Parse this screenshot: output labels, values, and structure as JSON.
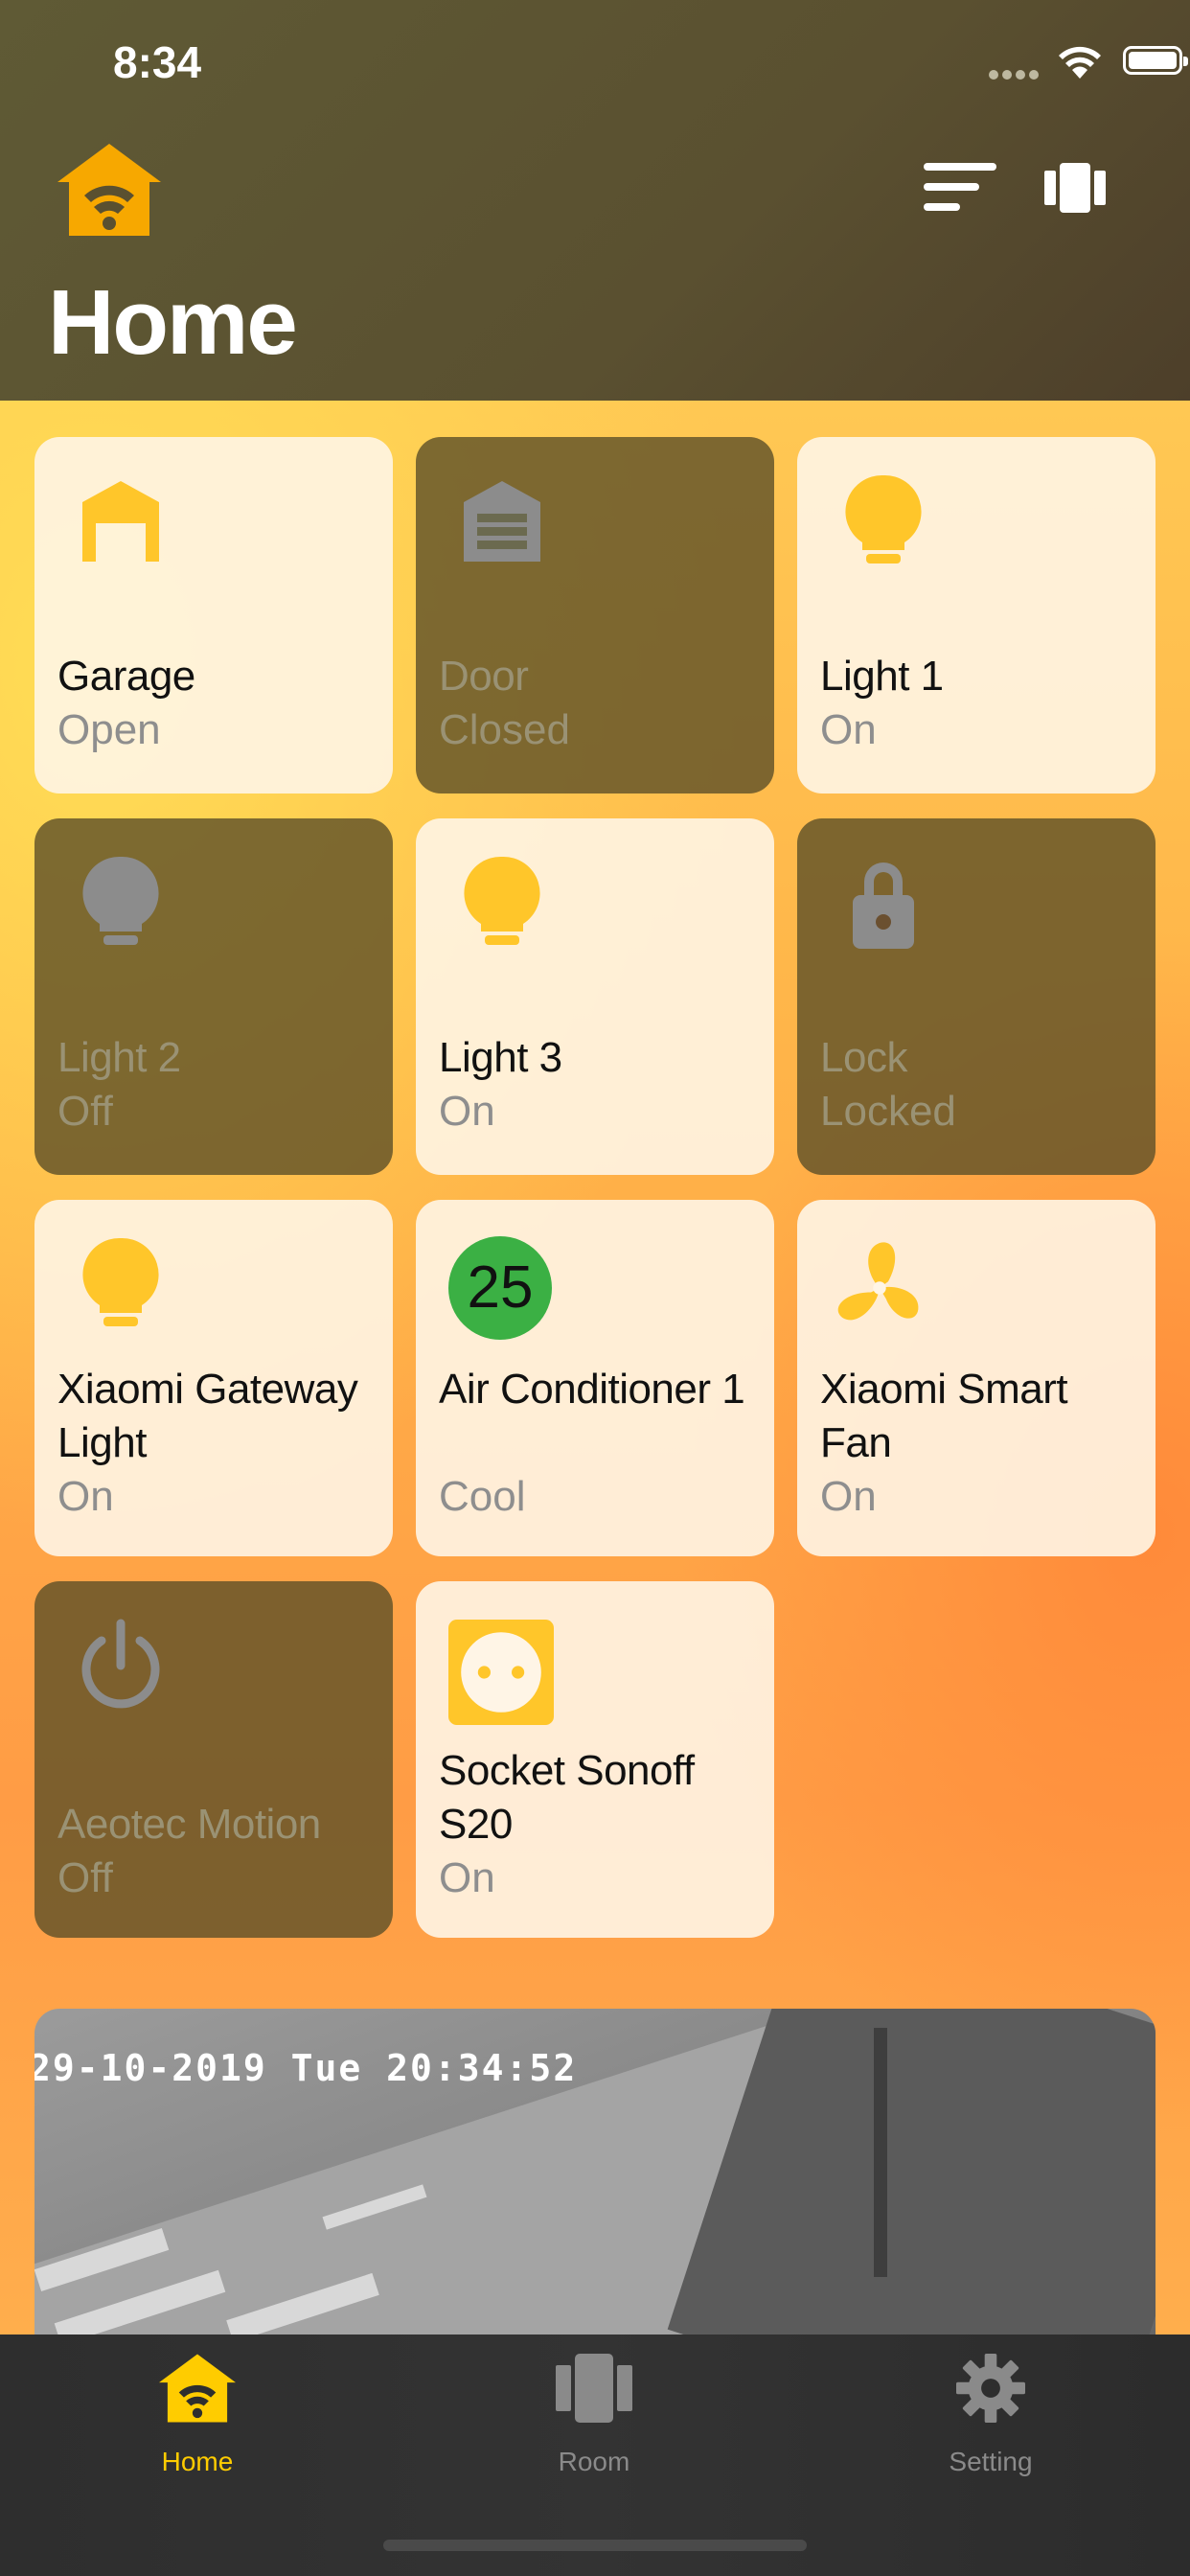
{
  "status_bar": {
    "time": "8:34"
  },
  "header": {
    "title": "Home"
  },
  "colors": {
    "accent": "#FFCC00",
    "on_tile": "#FFF5E6",
    "off_tile": "#605228",
    "ac_badge": "#3BB044"
  },
  "devices": [
    {
      "name": "Garage",
      "state": "Open",
      "icon": "garage-open-icon",
      "active": true
    },
    {
      "name": "Door",
      "state": "Closed",
      "icon": "garage-closed-icon",
      "active": false
    },
    {
      "name": "Light 1",
      "state": "On",
      "icon": "bulb-icon",
      "active": true
    },
    {
      "name": "Light 2",
      "state": "Off",
      "icon": "bulb-icon",
      "active": false
    },
    {
      "name": "Light 3",
      "state": "On",
      "icon": "bulb-icon",
      "active": true
    },
    {
      "name": "Lock",
      "state": "Locked",
      "icon": "lock-icon",
      "active": false
    },
    {
      "name": "Xiaomi Gateway Light",
      "state": "On",
      "icon": "bulb-icon",
      "active": true
    },
    {
      "name": "Air Conditioner 1",
      "state": "Cool",
      "icon": "temperature-badge-icon",
      "badge": "25",
      "active": true
    },
    {
      "name": "Xiaomi Smart Fan",
      "state": "On",
      "icon": "fan-icon",
      "active": true
    },
    {
      "name": "Aeotec Motion",
      "state": "Off",
      "icon": "power-icon",
      "active": false
    },
    {
      "name": "Socket Sonoff S20",
      "state": "On",
      "icon": "socket-icon",
      "active": true
    }
  ],
  "camera": {
    "timestamp": "29-10-2019 Tue 20:34:52"
  },
  "tabs": [
    {
      "label": "Home",
      "icon": "home-wifi-icon",
      "active": true
    },
    {
      "label": "Room",
      "icon": "room-icon",
      "active": false
    },
    {
      "label": "Setting",
      "icon": "gear-icon",
      "active": false
    }
  ]
}
